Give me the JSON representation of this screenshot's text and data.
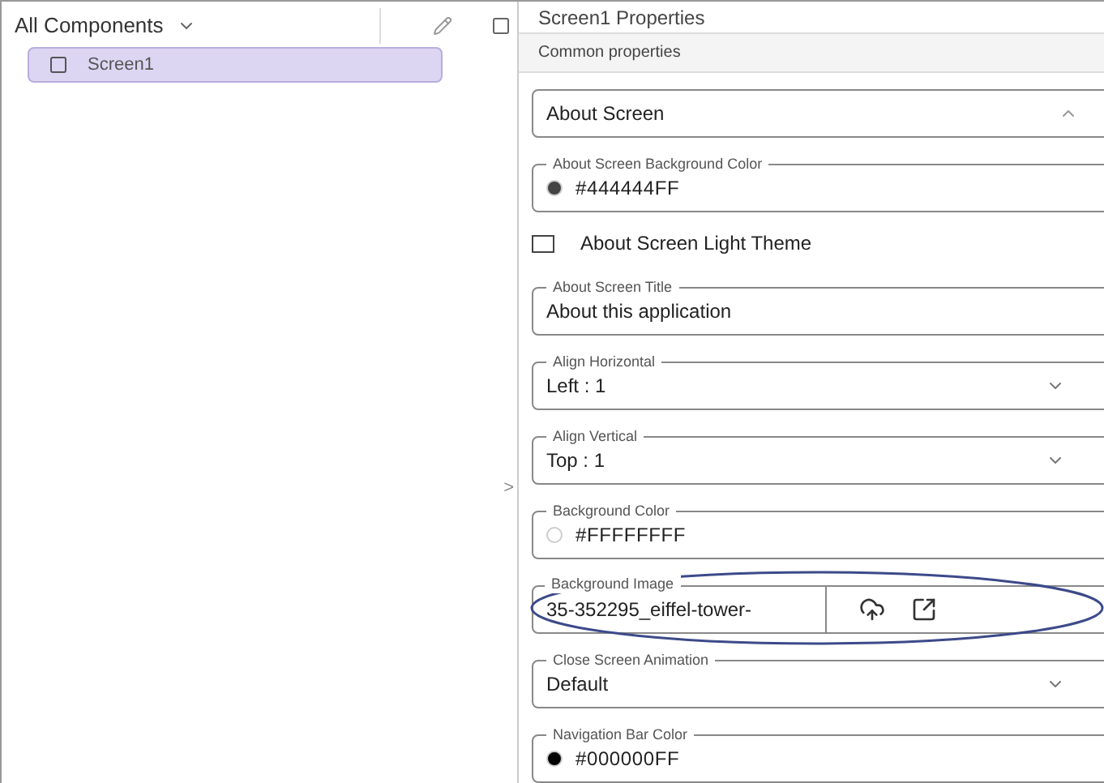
{
  "components": {
    "filter": "All Components",
    "items": [
      {
        "label": "Screen1",
        "selected": true
      }
    ],
    "collapse_glyph": ">"
  },
  "properties": {
    "title": "Screen1 Properties",
    "section": "Common properties",
    "fields": [
      {
        "kind": "accordion",
        "value": "About Screen"
      },
      {
        "kind": "color",
        "label": "About Screen Background Color",
        "value": "#444444FF",
        "color": "#444444"
      },
      {
        "kind": "checkbox",
        "label": "About Screen Light Theme",
        "checked": false
      },
      {
        "kind": "text",
        "label": "About Screen Title",
        "value": "About this application"
      },
      {
        "kind": "select",
        "label": "Align Horizontal",
        "value": "Left : 1"
      },
      {
        "kind": "select",
        "label": "Align Vertical",
        "value": "Top : 1"
      },
      {
        "kind": "color",
        "label": "Background Color",
        "value": "#FFFFFFFF",
        "color": "#ffffff"
      },
      {
        "kind": "file",
        "label": "Background Image",
        "value": "35-352295_eiffel-tower-",
        "circled": true
      },
      {
        "kind": "select",
        "label": "Close Screen Animation",
        "value": "Default"
      },
      {
        "kind": "color",
        "label": "Navigation Bar Color",
        "value": "#000000FF",
        "color": "#000000"
      }
    ]
  }
}
